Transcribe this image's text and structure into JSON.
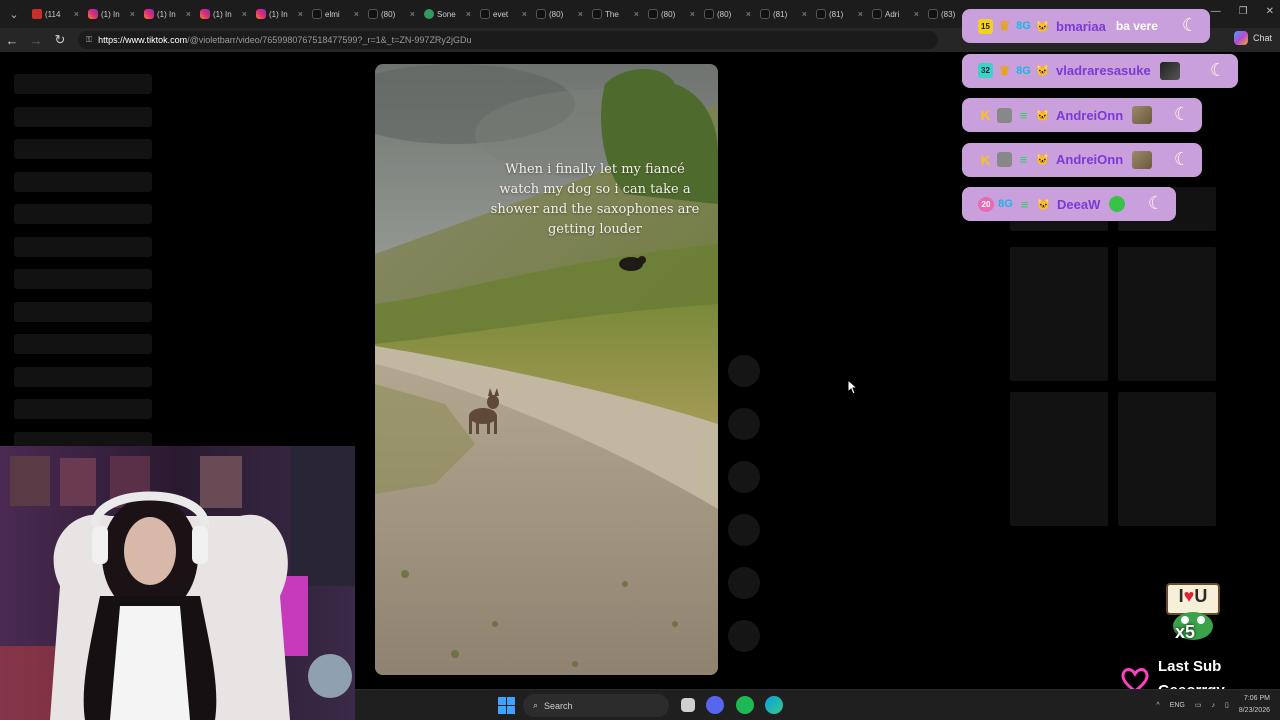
{
  "browser": {
    "menu_icon": "chevron-down",
    "tabs": [
      {
        "title": "(114",
        "favicon": "yt"
      },
      {
        "title": "(1) In",
        "favicon": "ig"
      },
      {
        "title": "(1) In",
        "favicon": "ig"
      },
      {
        "title": "(1) In",
        "favicon": "ig"
      },
      {
        "title": "(1) In",
        "favicon": "ig"
      },
      {
        "title": "elmi",
        "favicon": "tt"
      },
      {
        "title": "(80)",
        "favicon": "tt"
      },
      {
        "title": "Sone",
        "favicon": "sc"
      },
      {
        "title": "evet",
        "favicon": "tt"
      },
      {
        "title": "(80)",
        "favicon": "tt"
      },
      {
        "title": "The",
        "favicon": "tt"
      },
      {
        "title": "(80)",
        "favicon": "tt"
      },
      {
        "title": "(80)",
        "favicon": "tt"
      },
      {
        "title": "(81)",
        "favicon": "tt"
      },
      {
        "title": "(81)",
        "favicon": "tt"
      },
      {
        "title": "Adri",
        "favicon": "tt"
      },
      {
        "title": "(83)",
        "favicon": "tt"
      }
    ],
    "tab_close": "×",
    "new_tab": "+",
    "url_host": "https://www.tiktok.com",
    "url_path": "/@violetbarr/video/7659980767518477599?_r=1&_t=ZN-997ZRy2jGDu",
    "copilot_label": "Chat"
  },
  "video": {
    "caption": "When i finally let my fiancé watch my dog so i can take a shower and the saxophones are getting louder"
  },
  "chat": [
    {
      "badges": [
        "15",
        "crown",
        "bg",
        "cat"
      ],
      "badge_num_style": "gold",
      "user": "bmariaa",
      "message": "ba vere",
      "user_color": "#7a3ad6",
      "emote": ""
    },
    {
      "badges": [
        "32",
        "crown",
        "bg",
        "cat"
      ],
      "badge_num_style": "teal",
      "user": "vladraresasuke",
      "message": "",
      "user_color": "#7a3ad6",
      "emote": "dark"
    },
    {
      "badges": [
        "K",
        "tool",
        "grn",
        "cat"
      ],
      "badge_num_style": "",
      "user": "AndreiOnn",
      "message": "",
      "user_color": "#7a3ad6",
      "emote": "cat"
    },
    {
      "badges": [
        "K",
        "tool",
        "grn",
        "cat"
      ],
      "badge_num_style": "",
      "user": "AndreiOnn",
      "message": "",
      "user_color": "#7a3ad6",
      "emote": "cat"
    },
    {
      "badges": [
        "20",
        "bg",
        "grn",
        "cat"
      ],
      "badge_num_style": "pink",
      "user": "DeeaW",
      "message": "",
      "user_color": "#7a3ad6",
      "emote": "green"
    }
  ],
  "alerts": {
    "iloveu_text": "I",
    "iloveu_heart": "♥",
    "iloveu_u": "U",
    "iloveu_count": "x5",
    "last_sub_label": "Last Sub",
    "last_sub_user": "Geeorrgy"
  },
  "taskbar": {
    "search_placeholder": "Search",
    "language": "ENG",
    "time": "7:06 PM",
    "date": "8/23/2026"
  }
}
